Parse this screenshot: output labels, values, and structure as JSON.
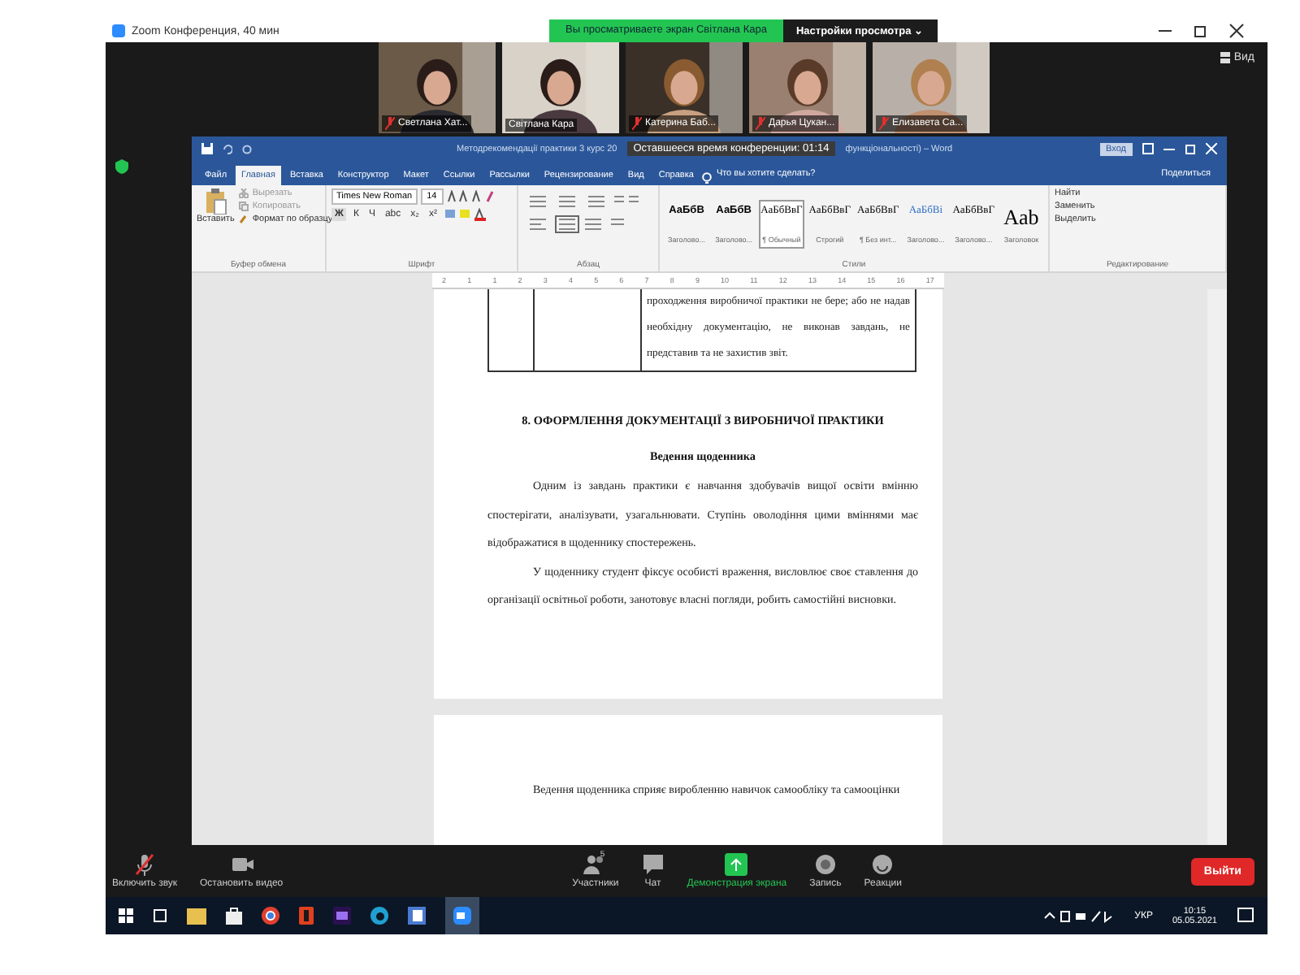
{
  "zoom_window": {
    "title": "Zoom Конференция, 40 мин",
    "share_banner": "Вы просматриваете экран Світлана Кара",
    "view_options": "Настройки просмотра ⌄",
    "view_button": "Вид"
  },
  "participants": [
    {
      "name": "Светлана Хат...",
      "muted": true
    },
    {
      "name": "Світлана Кара",
      "muted": false
    },
    {
      "name": "Катерина Баб...",
      "muted": true
    },
    {
      "name": "Дарья Цукан...",
      "muted": true
    },
    {
      "name": "Елизавета Са...",
      "muted": true
    }
  ],
  "word": {
    "title_left": "Методрекомендації практики 3 курс 20",
    "title_right": "функціональності) – Word",
    "timer": "Оставшееся время конференции: 01:14",
    "signin": "Вход",
    "tabs": [
      {
        "label": "Файл",
        "selected": false
      },
      {
        "label": "Главная",
        "selected": true
      },
      {
        "label": "Вставка",
        "selected": false
      },
      {
        "label": "Конструктор",
        "selected": false
      },
      {
        "label": "Макет",
        "selected": false
      },
      {
        "label": "Ссылки",
        "selected": false
      },
      {
        "label": "Рассылки",
        "selected": false
      },
      {
        "label": "Рецензирование",
        "selected": false
      },
      {
        "label": "Вид",
        "selected": false
      },
      {
        "label": "Справка",
        "selected": false
      }
    ],
    "tell_me": "Что вы хотите сделать?",
    "share": "Поделиться",
    "clipboard": {
      "paste": "Вставить",
      "cut": "Вырезать",
      "copy": "Копировать",
      "format_painter": "Формат по образцу",
      "label": "Буфер обмена"
    },
    "font": {
      "name": "Times New Roman",
      "size": "14",
      "format_buttons": [
        "Ж",
        "К",
        "Ч",
        "abc",
        "x₂",
        "x²"
      ],
      "label": "Шрифт"
    },
    "paragraph": {
      "label": "Абзац"
    },
    "styles": {
      "label": "Стили",
      "items": [
        {
          "sample": "АаБбВ",
          "name": "Заголово...",
          "selected": false
        },
        {
          "sample": "АаБбВ",
          "name": "Заголово...",
          "selected": false
        },
        {
          "sample": "АаБбВвГ",
          "name": "¶ Обычный",
          "selected": true
        },
        {
          "sample": "АаБбВвГ",
          "name": "Строгий",
          "selected": false
        },
        {
          "sample": "АаБбВвГ",
          "name": "¶ Без инт...",
          "selected": false
        },
        {
          "sample": "АаБбВі",
          "name": "Заголово...",
          "selected": false
        },
        {
          "sample": "АаБбВвГ",
          "name": "Заголово...",
          "selected": false
        },
        {
          "sample": "Aab",
          "name": "Заголовок",
          "selected": false
        }
      ]
    },
    "editing": {
      "label": "Редактирование",
      "items": [
        "Найти",
        "Заменить",
        "Выделить"
      ]
    },
    "ruler": [
      "2",
      "1",
      "1",
      "2",
      "3",
      "4",
      "5",
      "6",
      "7",
      "8",
      "9",
      "10",
      "11",
      "12",
      "13",
      "14",
      "15",
      "16",
      "17"
    ],
    "document": {
      "table_cell": "проходження виробничої практики не бере; або не надав необхідну документацію, не виконав завдань, не представив та не захистив звіт.",
      "heading": "8. ОФОРМЛЕННЯ ДОКУМЕНТАЦІЇ З ВИРОБНИЧОЇ ПРАКТИКИ",
      "subheading": "Ведення щоденника",
      "paragraphs": [
        "Одним із завдань практики є навчання здобувачів вищої освіти вмінню спостерігати, аналізувати, узагальнювати. Ступінь оволодіння цими вміннями має відображатися в щоденнику спостережень.",
        "У щоденнику студент фіксує особисті враження, висловлює своє ставлення до організації освітньої роботи, занотовує власні погляди, робить самостійні висновки."
      ],
      "next_page": "Ведення щоденника сприяє виробленню навичок самообліку та самооцінки"
    }
  },
  "toolbar": {
    "items": [
      {
        "label": "Включить звук",
        "kind": "mic",
        "highlighted": false
      },
      {
        "label": "Остановить видео",
        "kind": "video",
        "highlighted": false
      },
      {
        "label": "Участники",
        "kind": "participants",
        "highlighted": false
      },
      {
        "label": "Чат",
        "kind": "chat",
        "highlighted": false
      },
      {
        "label": "Демонстрация экрана",
        "kind": "share",
        "highlighted": true
      },
      {
        "label": "Запись",
        "kind": "record",
        "highlighted": false
      },
      {
        "label": "Реакции",
        "kind": "reactions",
        "highlighted": false
      }
    ],
    "participant_count": "5",
    "leave": "Выйти"
  },
  "taskbar": {
    "language": "УКР",
    "time": "10:15",
    "date": "05.05.2021"
  }
}
